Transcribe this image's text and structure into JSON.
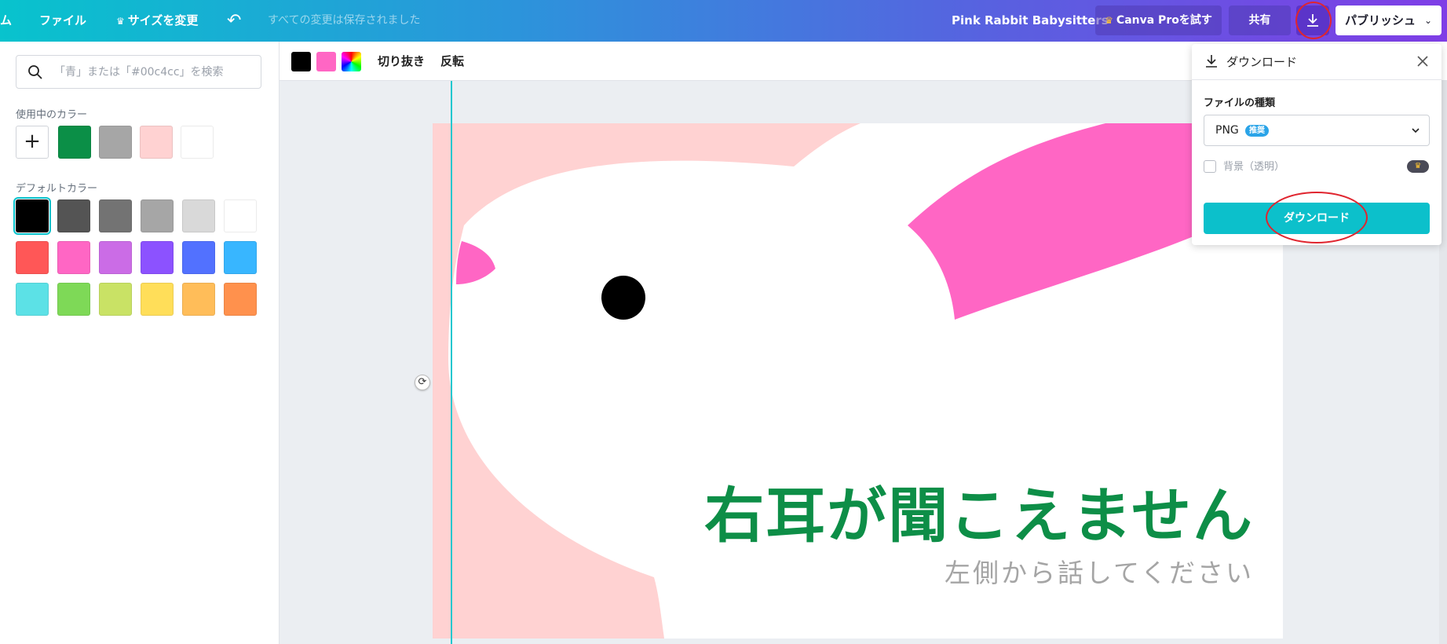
{
  "topbar": {
    "home_label": "ム",
    "file_label": "ファイル",
    "resize_label": "サイズを変更",
    "undo_icon": "undo-icon",
    "save_status": "すべての変更は保存されました",
    "design_title": "Pink Rabbit Babysitters",
    "pro_label": "Canva Proを試す",
    "share_label": "共有",
    "publish_label": "パブリッシュ"
  },
  "left_panel": {
    "search_placeholder": "「青」または「#00c4cc」を検索",
    "used_colors_label": "使用中のカラー",
    "used_colors": [
      "#0b8f47",
      "#a6a6a6",
      "#ffd2d2",
      "#ffffff"
    ],
    "default_colors_label": "デフォルトカラー",
    "default_colors": [
      "#000000",
      "#545454",
      "#737373",
      "#a6a6a6",
      "#d9d9d9",
      "#ffffff",
      "#ff5757",
      "#ff66c4",
      "#cb6ce6",
      "#8c52ff",
      "#5271ff",
      "#38b6ff",
      "#5ce1e6",
      "#7ed957",
      "#c9e265",
      "#ffde59",
      "#ffbd59",
      "#ff914d"
    ]
  },
  "canvas_toolbar": {
    "colors": [
      "#000000",
      "#ff66c4"
    ],
    "crop_label": "切り抜き",
    "flip_label": "反転"
  },
  "artboard": {
    "headline": "右耳が聞こえません",
    "subline": "左側から話してください",
    "colors": {
      "background": "#ffd2d2",
      "ear": "#ff66c4",
      "text": "#0d8e47",
      "sub": "#a5a5a5"
    }
  },
  "download_panel": {
    "title": "ダウンロード",
    "file_type_label": "ファイルの種類",
    "file_type_value": "PNG",
    "recommended_badge": "推奨",
    "transparent_label": "背景（透明）",
    "download_button": "ダウンロード"
  }
}
